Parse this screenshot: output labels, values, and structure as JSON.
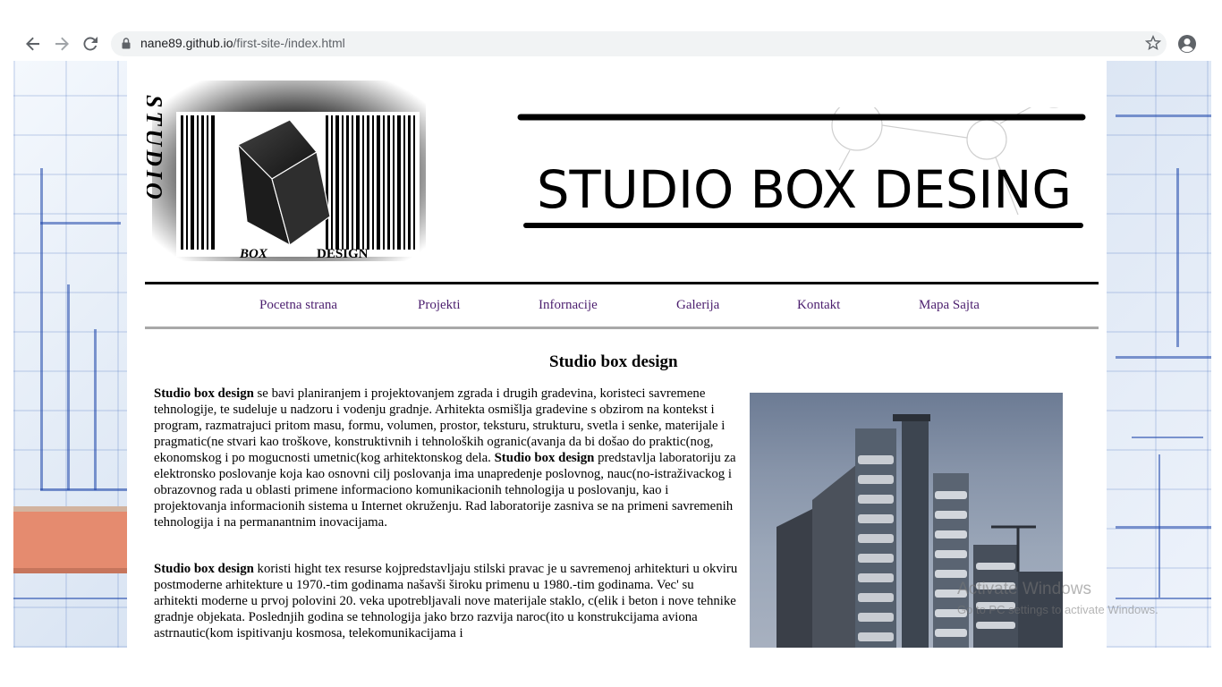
{
  "browser": {
    "url_domain": "nane89.github.io",
    "url_path": "/first-site-/index.html",
    "back_icon": "arrow-back-icon",
    "forward_icon": "arrow-forward-icon",
    "reload_icon": "reload-icon",
    "lock_icon": "lock-icon",
    "bookmark_icon": "star-icon",
    "profile_icon": "account-circle-icon"
  },
  "header": {
    "logo_vertical": "STUDIO",
    "logo_bottom_left": "BOX",
    "logo_bottom_right": "DESIGN",
    "title": "STUDIO BOX DESING"
  },
  "nav": {
    "items": [
      "Pocetna strana",
      "Projekti",
      "Infornacije",
      "Galerija",
      "Kontakt",
      "Mapa Sajta"
    ]
  },
  "main": {
    "heading": "Studio box design",
    "p1_lead": "Studio box design",
    "p1_body": " se bavi planiranjem i projektovanjem zgrada i drugih gradevina, koristeci savremene tehnologije, te sudeluje u nadzoru i vodenju gradnje. Arhitekta osmišlja gradevine s obzirom na kontekst i program, razmatrajuci pritom masu, formu, volumen, prostor, teksturu, strukturu, svetla i senke, materijale i pragmatic(ne stvari kao troškove, konstruktivnih i tehnoloških ogranic(avanja da bi došao do praktic(nog, ekonomskog i po mogucnosti umetnic(kog arhitektonskog dela. ",
    "p1_lead2": "Studio box design",
    "p1_body2": " predstavlja laboratoriju za elektronsko poslovanje koja kao osnovni cilj poslovanja ima unapredenje poslovnog, nauc(no-istraživackog i obrazovnog rada u oblasti primene informaciono komunikacionih tehnologija u poslovanju, kao i projektovanja informacionih sistema u Internet okruženju. Rad laboratorije zasniva se na primeni savremenih tehnologija i na permanantnim inovacijama.",
    "p2_lead": "Studio box design",
    "p2_body": " koristi hight tex resurse kojpredstavljaju stilski pravac je u savremenoj arhitekturi u okviru postmoderne arhitekture u 1970.-tim godinama našavši široku primenu u 1980.-tim godinama. Vec' su arhitekti moderne u prvoj polovini 20. veka upotrebljavali nove materijale staklo, c(elik i beton i nove tehnike gradnje objekata. Poslednjih godina se tehnologija jako brzo razvija naroc(ito u konstrukcijama aviona astrnautic(kom ispitivanju kosmosa, telekomunikacijama i"
  },
  "watermark": {
    "line1": "Activate Windows",
    "line2": "Go to PC settings to activate Windows."
  }
}
